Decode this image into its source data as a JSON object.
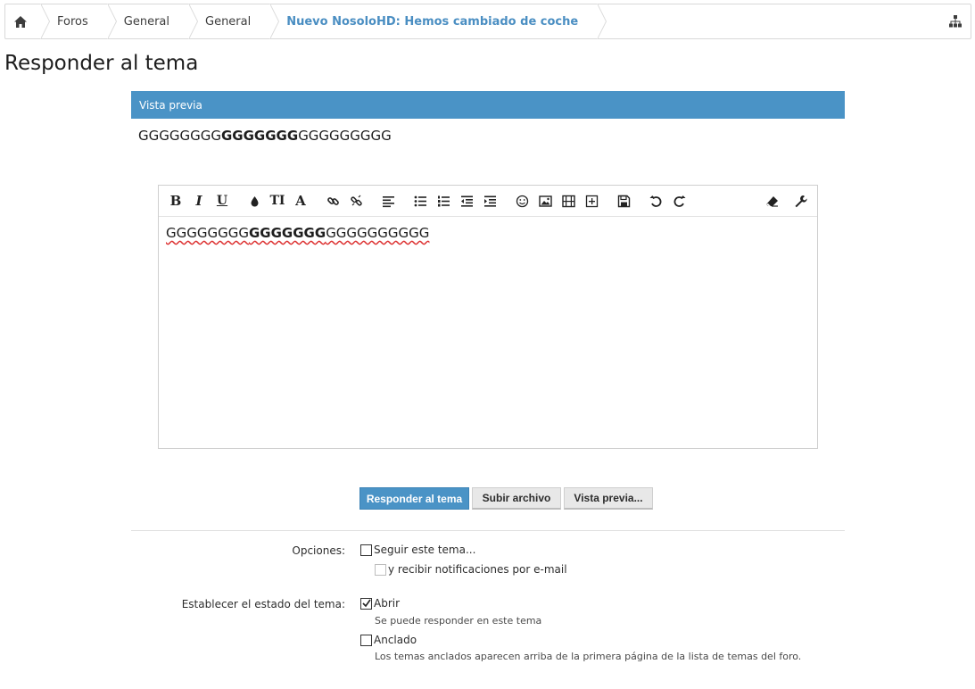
{
  "breadcrumb": {
    "items": [
      "Foros",
      "General",
      "General"
    ],
    "current": "Nuevo NosoloHD: Hemos cambiado de coche"
  },
  "page": {
    "title": "Responder al tema"
  },
  "preview": {
    "header": "Vista previa",
    "text_before": "GGGGGGGG",
    "text_bold": "GGGGGGG",
    "text_after": "GGGGGGGGG"
  },
  "editor": {
    "text_before": "GGGGGGGG",
    "text_bold": "GGGGGGG",
    "text_after": "GGGGGGGGGG",
    "toolbar": {
      "bold": "B",
      "italic": "I",
      "underline": "U",
      "font_size": "TI",
      "font": "A"
    }
  },
  "buttons": {
    "reply": "Responder al tema",
    "upload": "Subir archivo",
    "preview": "Vista previa..."
  },
  "options": {
    "label": "Opciones:",
    "follow": "Seguir este tema...",
    "email": "y recibir notificaciones por e-mail"
  },
  "status": {
    "label": "Establecer el estado del tema:",
    "open": "Abrir",
    "open_hint": "Se puede responder en este tema",
    "sticky": "Anclado",
    "sticky_hint": "Los temas anclados aparecen arriba de la primera página de la lista de temas del foro."
  },
  "state": {
    "follow_checked": false,
    "email_checked": false,
    "open_checked": true,
    "sticky_checked": false
  },
  "colors": {
    "accent": "#4a93c6",
    "link": "#4a8ec2"
  }
}
